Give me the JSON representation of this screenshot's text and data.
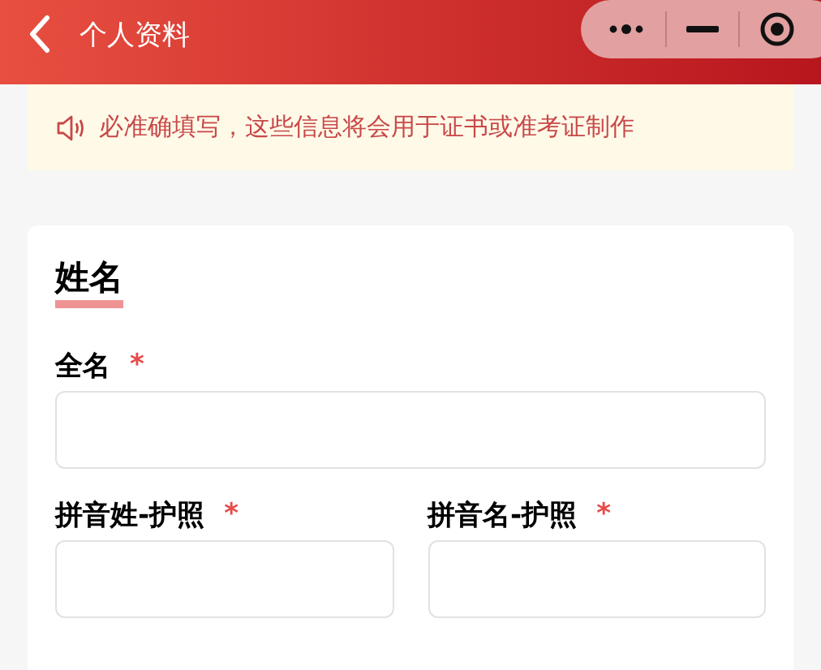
{
  "nav_bar": {
    "title": "个人资料"
  },
  "notice": {
    "text": "必准确填写，这些信息将会用于证书或准考证制作"
  },
  "section": {
    "title": "姓名",
    "fields": [
      {
        "kind": "full",
        "label": "全名",
        "required_mark": "*"
      },
      {
        "kind": "half",
        "label": "拼音姓-护照",
        "required_mark": "*"
      },
      {
        "kind": "half",
        "label": "拼音名-护照",
        "required_mark": "*"
      }
    ]
  }
}
